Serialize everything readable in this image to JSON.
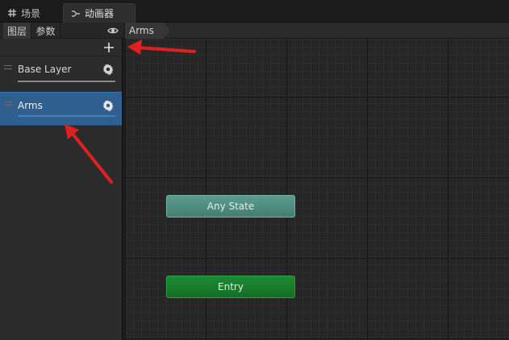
{
  "tabs": [
    {
      "label": "场景",
      "icon": "grid-icon"
    },
    {
      "label": "动画器",
      "icon": "branch-icon"
    }
  ],
  "left_panel": {
    "subtabs": [
      "图层",
      "参数"
    ],
    "layers": [
      {
        "name": "Base Layer",
        "selected": false
      },
      {
        "name": "Arms",
        "selected": true
      }
    ]
  },
  "canvas": {
    "breadcrumb": "Arms",
    "nodes": [
      {
        "label": "Any State",
        "color": "#4f8f82"
      },
      {
        "label": "Entry",
        "color": "#187d2d"
      }
    ]
  },
  "colors": {
    "selection": "#2f5f8f",
    "annotation_arrow": "#e02020"
  }
}
